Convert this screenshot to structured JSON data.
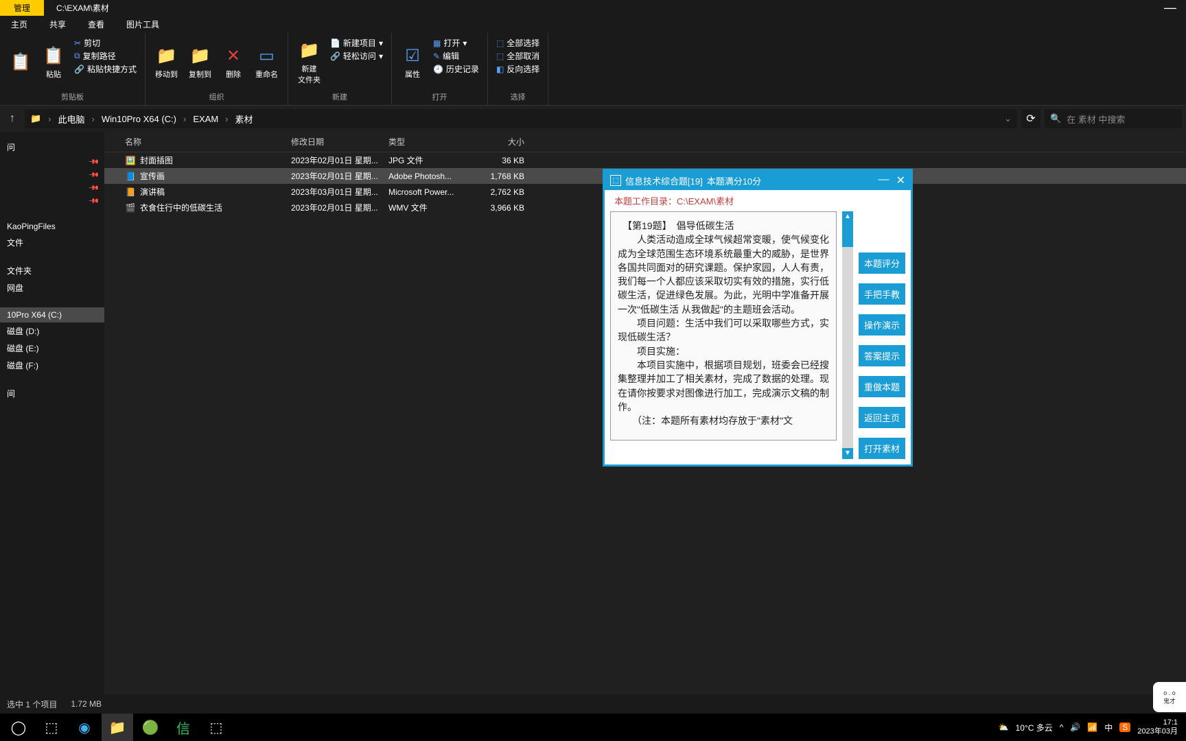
{
  "titlebar": {
    "tab": "管理",
    "path": "C:\\EXAM\\素材"
  },
  "tabs": [
    "主页",
    "共享",
    "查看",
    "图片工具"
  ],
  "ribbon": {
    "clipboard": {
      "paste": "粘贴",
      "cut": "剪切",
      "copypath": "复制路径",
      "paste_shortcut": "粘贴快捷方式",
      "group": "剪贴板"
    },
    "organize": {
      "moveto": "移动到",
      "copyto": "复制到",
      "delete": "删除",
      "rename": "重命名",
      "group": "组织"
    },
    "new": {
      "newfolder": "新建\n文件夹",
      "newitem": "新建项目",
      "easyaccess": "轻松访问",
      "group": "新建"
    },
    "open": {
      "properties": "属性",
      "open": "打开",
      "edit": "编辑",
      "history": "历史记录",
      "group": "打开"
    },
    "select": {
      "selectall": "全部选择",
      "selectnone": "全部取消",
      "invert": "反向选择",
      "group": "选择"
    }
  },
  "breadcrumb": [
    "此电脑",
    "Win10Pro X64 (C:)",
    "EXAM",
    "素材"
  ],
  "search_placeholder": "在 素材 中搜索",
  "columns": {
    "name": "名称",
    "date": "修改日期",
    "type": "类型",
    "size": "大小"
  },
  "files": [
    {
      "icon": "🖼️",
      "name": "封面插图",
      "date": "2023年02月01日 星期...",
      "type": "JPG 文件",
      "size": "36 KB"
    },
    {
      "icon": "📘",
      "name": "宣传画",
      "date": "2023年02月01日 星期...",
      "type": "Adobe Photosh...",
      "size": "1,768 KB",
      "selected": true
    },
    {
      "icon": "📙",
      "name": "演讲稿",
      "date": "2023年03月01日 星期...",
      "type": "Microsoft Power...",
      "size": "2,762 KB"
    },
    {
      "icon": "🎬",
      "name": "衣食住行中的低碳生活",
      "date": "2023年02月01日 星期...",
      "type": "WMV 文件",
      "size": "3,966 KB"
    }
  ],
  "sidebar": {
    "quick": "问",
    "pins": [
      "",
      "",
      "",
      ""
    ],
    "items": [
      "KaoPingFiles",
      "文件",
      "",
      "文件夹",
      "网盘",
      "",
      "10Pro X64 (C:)",
      "磁盘 (D:)",
      "磁盘 (E:)",
      "磁盘 (F:)",
      "",
      "间"
    ],
    "sel_index": 6
  },
  "statusbar": {
    "left": "选中 1 个项目",
    "right": "1.72 MB"
  },
  "exam": {
    "title": "信息技术综合题[19]",
    "score": "本题满分10分",
    "subheader": "本题工作目录：C:\\EXAM\\素材",
    "body_lines": [
      "　【第19题】　倡导低碳生活",
      "　　人类活动造成全球气候超常变暖，使气候变化成为全球范围生态环境系统最重大的威胁，是世界各国共同面对的研究课题。保护家园，人人有责，我们每一个人都应该采取切实有效的措施，实行低碳生活，促进绿色发展。为此，光明中学准备开展一次\"低碳生活 从我做起\"的主题班会活动。",
      "　　项目问题：生活中我们可以采取哪些方式，实现低碳生活？",
      "　　项目实施：",
      "　　本项目实施中，根据项目规划，班委会已经搜集整理并加工了相关素材，完成了数据的处理。现在请你按要求对图像进行加工，完成演示文稿的制作。",
      "　　（注：本题所有素材均存放于\"素材\"文"
    ],
    "buttons": [
      "本题评分",
      "手把手教",
      "操作演示",
      "答案提示",
      "重做本题",
      "返回主页",
      "打开素材"
    ]
  },
  "taskbar": {
    "weather": "10°C 多云",
    "ime": "中",
    "time": "17:1",
    "date": "2023年03月"
  },
  "avatar_label": "鬼才"
}
